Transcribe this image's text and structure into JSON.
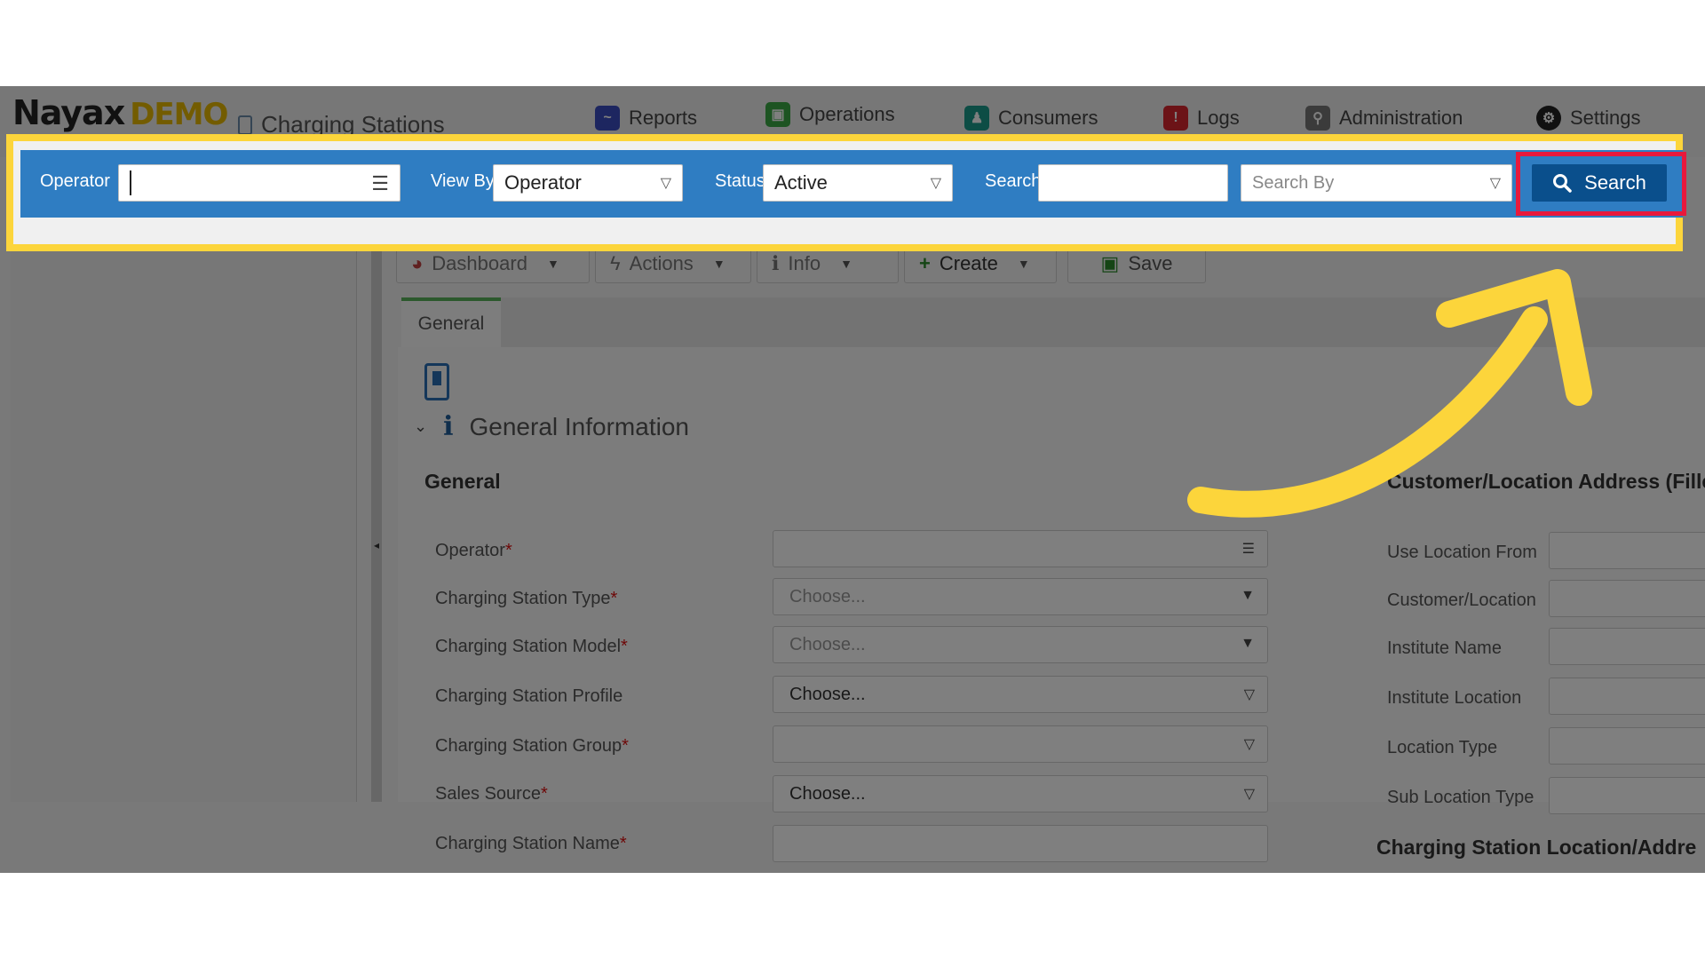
{
  "brand": {
    "logo": "Nayax",
    "demo": "DEMO"
  },
  "page_title": "Charging Stations",
  "nav": [
    {
      "label": "Reports",
      "icon": "reports-icon",
      "color": "#3b4cc0"
    },
    {
      "label": "Operations",
      "icon": "operations-icon",
      "color": "#3aa845"
    },
    {
      "label": "Consumers",
      "icon": "consumers-icon",
      "color": "#1a9a8a"
    },
    {
      "label": "Logs",
      "icon": "logs-icon",
      "color": "#d9262f"
    },
    {
      "label": "Administration",
      "icon": "administration-icon",
      "color": "#777777"
    },
    {
      "label": "Settings",
      "icon": "settings-icon",
      "color": "#222222"
    }
  ],
  "searchbar": {
    "operator_label": "Operator",
    "operator_value": "",
    "viewby_label": "View By",
    "viewby_value": "Operator",
    "status_label": "Status",
    "status_value": "Active",
    "search_label": "Search",
    "search_value": "",
    "searchby_placeholder": "Search By",
    "search_button": "Search"
  },
  "toolbar": {
    "dashboard": "Dashboard",
    "actions": "Actions",
    "info": "Info",
    "create": "Create",
    "save": "Save"
  },
  "tabs": {
    "general": "General"
  },
  "section": {
    "title": "General Information",
    "left_heading": "General",
    "right_heading": "Customer/Location Address (Fille",
    "bottom_right_heading": "Charging Station Location/Addre"
  },
  "form": {
    "fields": [
      {
        "label": "Operator",
        "required": "*",
        "value": "",
        "icon": "list-icon"
      },
      {
        "label": "Charging Station Type",
        "required": "*",
        "value": "Choose...",
        "icon": "caret-down-icon"
      },
      {
        "label": "Charging Station Model",
        "required": "*",
        "value": "Choose...",
        "icon": "caret-down-icon"
      },
      {
        "label": "Charging Station Profile",
        "required": "",
        "value": "Choose...",
        "icon": "caret-down-icon"
      },
      {
        "label": "Charging Station Group",
        "required": "*",
        "value": "",
        "icon": "caret-down-icon"
      },
      {
        "label": "Sales Source",
        "required": "*",
        "value": "Choose...",
        "icon": "caret-down-icon"
      },
      {
        "label": "Charging Station Name",
        "required": "*",
        "value": "",
        "icon": ""
      }
    ],
    "right_fields": [
      "Use Location From",
      "Customer/Location",
      "Institute Name",
      "Institute Location",
      "Location Type",
      "Sub Location Type"
    ]
  },
  "colors": {
    "searchbar": "#2f7dc2",
    "search_button": "#0a4f8c",
    "highlight_yellow": "#fcd53b",
    "highlight_red": "#e8193c"
  }
}
